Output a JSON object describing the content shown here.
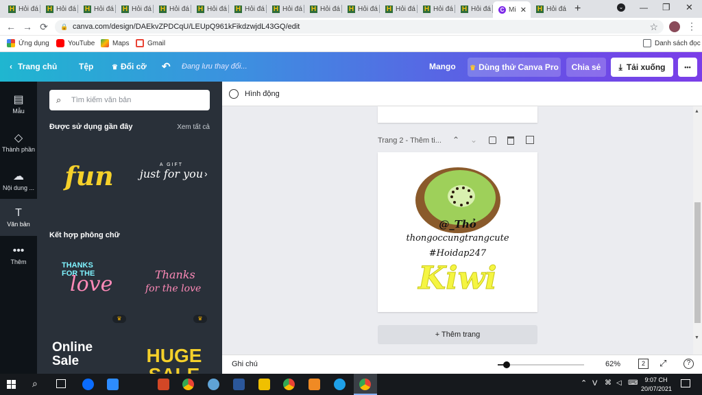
{
  "tabs": {
    "items": [
      "Hỏi đá",
      "Hỏi đá",
      "Hỏi đá",
      "Hỏi đá",
      "Hỏi đá",
      "Hỏi đá",
      "Hỏi đá",
      "Hỏi đá",
      "Hỏi đá",
      "Hỏi đá",
      "Hỏi đá",
      "Hỏi đá",
      "Hỏi đá"
    ],
    "active_title": "Mi",
    "last_title": "Hỏi đá",
    "fav_letter": "H",
    "active_fav": "C",
    "close": "✕",
    "new_tab": "+"
  },
  "window": {
    "minimize": "—",
    "restore": "❐",
    "close": "✕",
    "menu": "⌄"
  },
  "nav": {
    "back": "←",
    "forward": "→",
    "reload": "⟳",
    "url": "canva.com/design/DAEkvZPDCqU/LEUpQ961kFikdzwjdL43GQ/edit",
    "lock": "🔒",
    "star": "☆",
    "more": "⋮"
  },
  "bookmarks": {
    "apps": "Ứng dụng",
    "youtube": "YouTube",
    "maps": "Maps",
    "gmail": "Gmail",
    "reading_list": "Danh sách đọc"
  },
  "header": {
    "home": "Trang chủ",
    "file": "Tệp",
    "resize": "Đổi cỡ",
    "saving": "Đang lưu thay đổi...",
    "name": "Mango",
    "try_pro": "Dùng thử Canva Pro",
    "share": "Chia sẻ",
    "download": "Tải xuống",
    "more": "•••"
  },
  "rail": [
    {
      "label": "Mẫu",
      "icon": "▤"
    },
    {
      "label": "Thành phần",
      "icon": "◇"
    },
    {
      "label": "Nội dung ...",
      "icon": "☁"
    },
    {
      "label": "Văn bản",
      "icon": "T"
    },
    {
      "label": "Thêm",
      "icon": "•••"
    }
  ],
  "panel": {
    "search_placeholder": "Tìm kiếm văn bản",
    "recent_title": "Được sử dụng gần đây",
    "see_all": "Xem tất cả",
    "recent": [
      {
        "text": "fun"
      },
      {
        "small": "A GIFT",
        "text": "just for you"
      }
    ],
    "combos_title": "Kết hợp phông chữ",
    "combos": [
      {
        "line1": "THANKS",
        "line2": "FOR THE",
        "line3": "love"
      },
      {
        "line1": "Thanks",
        "line2": "for the love"
      }
    ],
    "more_combos": [
      {
        "line1": "Online",
        "line2": "Sale"
      },
      {
        "line1": "HUGE",
        "line2": "SALE"
      }
    ],
    "crown": "♛"
  },
  "canvas": {
    "animate": "Hình động",
    "page_label": "Trang 2 - Thêm ti...",
    "design_handle": "@_Thỏ",
    "design_line2": "thongoccungtrangcute",
    "design_line3": "#Hoidap247",
    "design_title": "Kiwi",
    "add_page": "+ Thêm trang",
    "notes": "Ghi chú",
    "zoom": "62%",
    "page_count": "2",
    "help": "?"
  },
  "taskbar": {
    "time": "9:07 CH",
    "date": "20/07/2021",
    "lang": "V"
  },
  "colors": {
    "brand_purple": "#7d2ae8",
    "header_start": "#1fb6d0",
    "header_end": "#7b3ee8",
    "kiwi_yellow": "#f5f542",
    "panel_bg": "#293039"
  }
}
